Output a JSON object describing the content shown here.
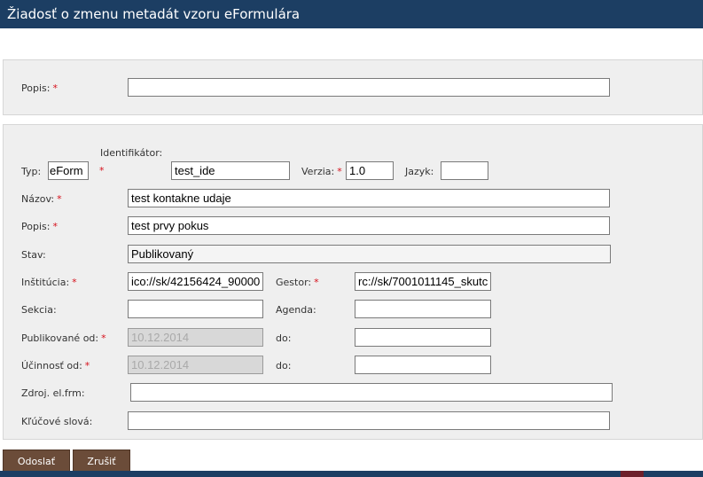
{
  "window": {
    "title": "Žiadosť o zmenu metadát vzoru eFormulára"
  },
  "form": {
    "top_popis": {
      "label": "Popis:",
      "value": ""
    },
    "required_mark": "*",
    "typ": {
      "label": "Typ:",
      "value": "eForm"
    },
    "identifikator": {
      "label": "Identifikátor:",
      "value": "test_ide"
    },
    "verzia": {
      "label": "Verzia:",
      "value": "1.0"
    },
    "jazyk": {
      "label": "Jazyk:",
      "value": ""
    },
    "nazov": {
      "label": "Názov:",
      "value": "test kontakne udaje"
    },
    "popis": {
      "label": "Popis:",
      "value": "test prvy pokus"
    },
    "stav": {
      "label": "Stav:",
      "value": "Publikovaný"
    },
    "institucia": {
      "label": "Inštitúcia:",
      "value": "ico://sk/42156424_90000"
    },
    "gestor": {
      "label": "Gestor:",
      "value": "rc://sk/7001011145_skutc"
    },
    "sekcia": {
      "label": "Sekcia:",
      "value": ""
    },
    "agenda": {
      "label": "Agenda:",
      "value": ""
    },
    "publikovane_od": {
      "label": "Publikované od:",
      "value": "10.12.2014"
    },
    "publikovane_do": {
      "label": "do:",
      "value": ""
    },
    "ucinnost_od": {
      "label": "Účinnosť od:",
      "value": "10.12.2014"
    },
    "ucinnost_do": {
      "label": "do:",
      "value": ""
    },
    "zdroj": {
      "label": "Zdroj. el.frm:",
      "value": ""
    },
    "klucove_slova": {
      "label": "Kľúčové slová:",
      "value": ""
    }
  },
  "buttons": {
    "submit": "Odoslať",
    "cancel": "Zrušiť"
  },
  "colors": {
    "titlebar": "#1c3e63",
    "button": "#6b4c39",
    "required": "#d6101b",
    "panel": "#efefef"
  }
}
